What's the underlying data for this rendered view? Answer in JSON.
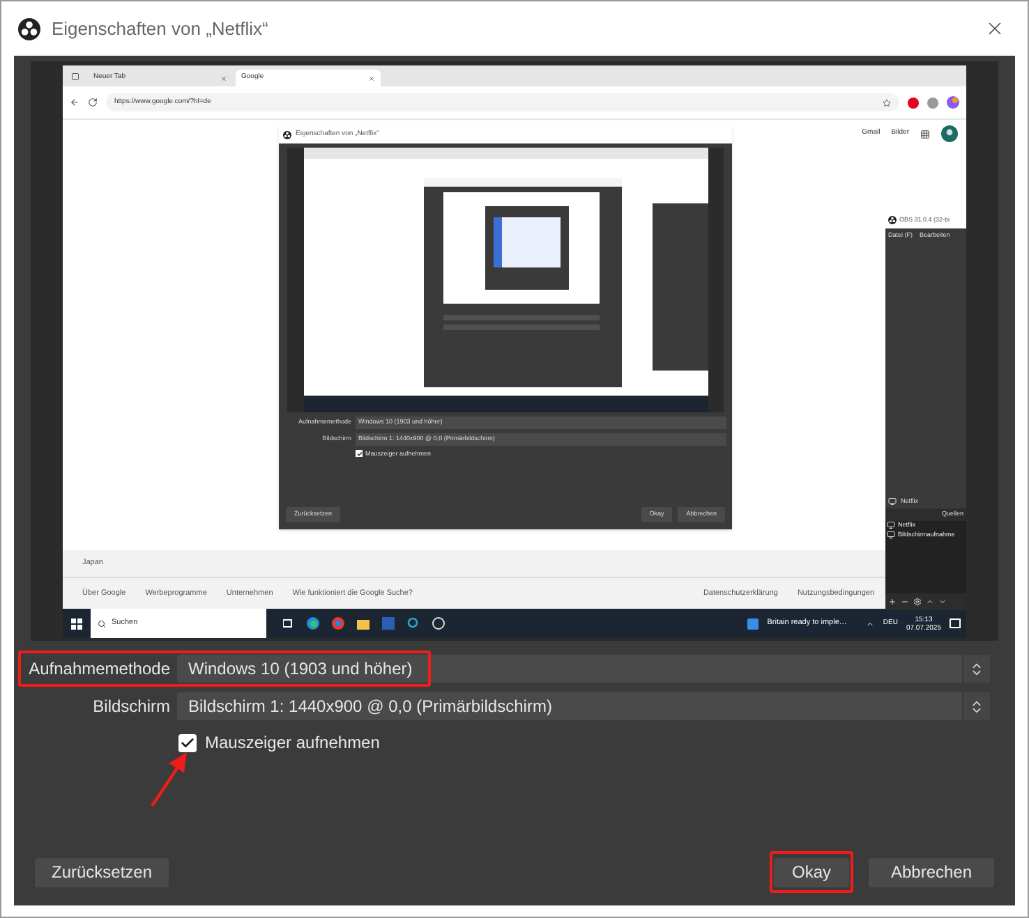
{
  "window": {
    "title": "Eigenschaften von „Netflix“"
  },
  "preview": {
    "tabs": [
      {
        "label": "Neuer Tab",
        "selected": false
      },
      {
        "label": "Google",
        "selected": true
      }
    ],
    "url": "https://www.google.com/?hl=de",
    "header_links": [
      "Gmail",
      "Bilder"
    ],
    "nested_dialog": {
      "title": "Eigenschaften von „Netflix“",
      "rows": [
        {
          "label": "Aufnahmemethode",
          "value": "Windows 10 (1903 und höher)"
        },
        {
          "label": "Bildschirm",
          "value": "Bildschirm 1: 1440x900 @ 0,0 (Primärbildschirm)"
        }
      ],
      "checkbox": {
        "label": "Mauszeiger aufnehmen",
        "checked": true
      },
      "buttons": [
        "Zurücksetzen",
        "Okay",
        "Abbrechen"
      ]
    },
    "obs_window": {
      "title": "OBS 31.0.4 (32-bi",
      "menu": [
        "Datei (F)",
        "Bearbeiten"
      ],
      "scene": "Netflix",
      "sources_header": "Quellen",
      "sources": [
        "Netflix",
        "Bildschirmaufnahme"
      ]
    },
    "footer": {
      "country": "Japan",
      "links_left": [
        "Über Google",
        "Werbeprogramme",
        "Unternehmen",
        "Wie funktioniert die Google Suche?"
      ],
      "links_right": [
        "Datenschutzerklärung",
        "Nutzungsbedingungen"
      ]
    },
    "taskbar": {
      "search": "Suchen",
      "notification": "Britain ready to imple…",
      "language": "DEU",
      "time": "15:13",
      "date": "07.07.2025"
    }
  },
  "fields": [
    {
      "label": "Aufnahmemethode",
      "value": "Windows 10 (1903 und höher)",
      "highlighted": true
    },
    {
      "label": "Bildschirm",
      "value": "Bildschirm 1: 1440x900 @ 0,0 (Primärbildschirm)",
      "highlighted": false
    }
  ],
  "checkbox": {
    "label": "Mauszeiger aufnehmen",
    "checked": true
  },
  "buttons": [
    {
      "label": "Zurücksetzen",
      "highlighted": false
    },
    {
      "label": "Okay",
      "highlighted": true
    },
    {
      "label": "Abbrechen",
      "highlighted": false
    }
  ]
}
